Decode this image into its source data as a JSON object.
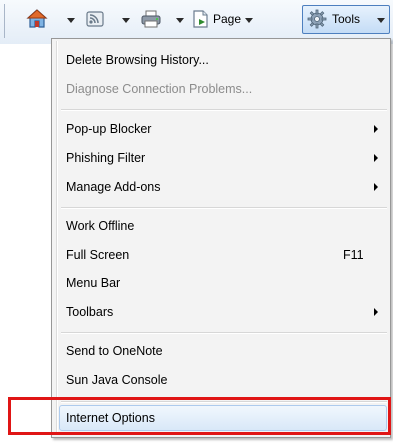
{
  "toolbar": {
    "page_label": "Page",
    "tools_label": "Tools",
    "icons": [
      "home-icon",
      "feeds-icon",
      "print-icon",
      "page-icon",
      "tools-gear-icon"
    ]
  },
  "menu": {
    "items": [
      {
        "label": "Delete Browsing History...",
        "enabled": true,
        "submenu": false
      },
      {
        "label": "Diagnose Connection Problems...",
        "enabled": false,
        "submenu": false
      },
      {
        "label": "Pop-up Blocker",
        "enabled": true,
        "submenu": true
      },
      {
        "label": "Phishing Filter",
        "enabled": true,
        "submenu": true
      },
      {
        "label": "Manage Add-ons",
        "enabled": true,
        "submenu": true
      },
      {
        "label": "Work Offline",
        "enabled": true,
        "submenu": false
      },
      {
        "label": "Full Screen",
        "enabled": true,
        "submenu": false,
        "shortcut": "F11"
      },
      {
        "label": "Menu Bar",
        "enabled": true,
        "submenu": false
      },
      {
        "label": "Toolbars",
        "enabled": true,
        "submenu": true
      },
      {
        "label": "Send to OneNote",
        "enabled": true,
        "submenu": false
      },
      {
        "label": "Sun Java Console",
        "enabled": true,
        "submenu": false
      },
      {
        "label": "Internet Options",
        "enabled": true,
        "submenu": false,
        "highlighted": true
      }
    ]
  },
  "colors": {
    "highlight_box": "#e01515",
    "hover_border": "#aecbed",
    "disabled_text": "#8c8c8c"
  }
}
